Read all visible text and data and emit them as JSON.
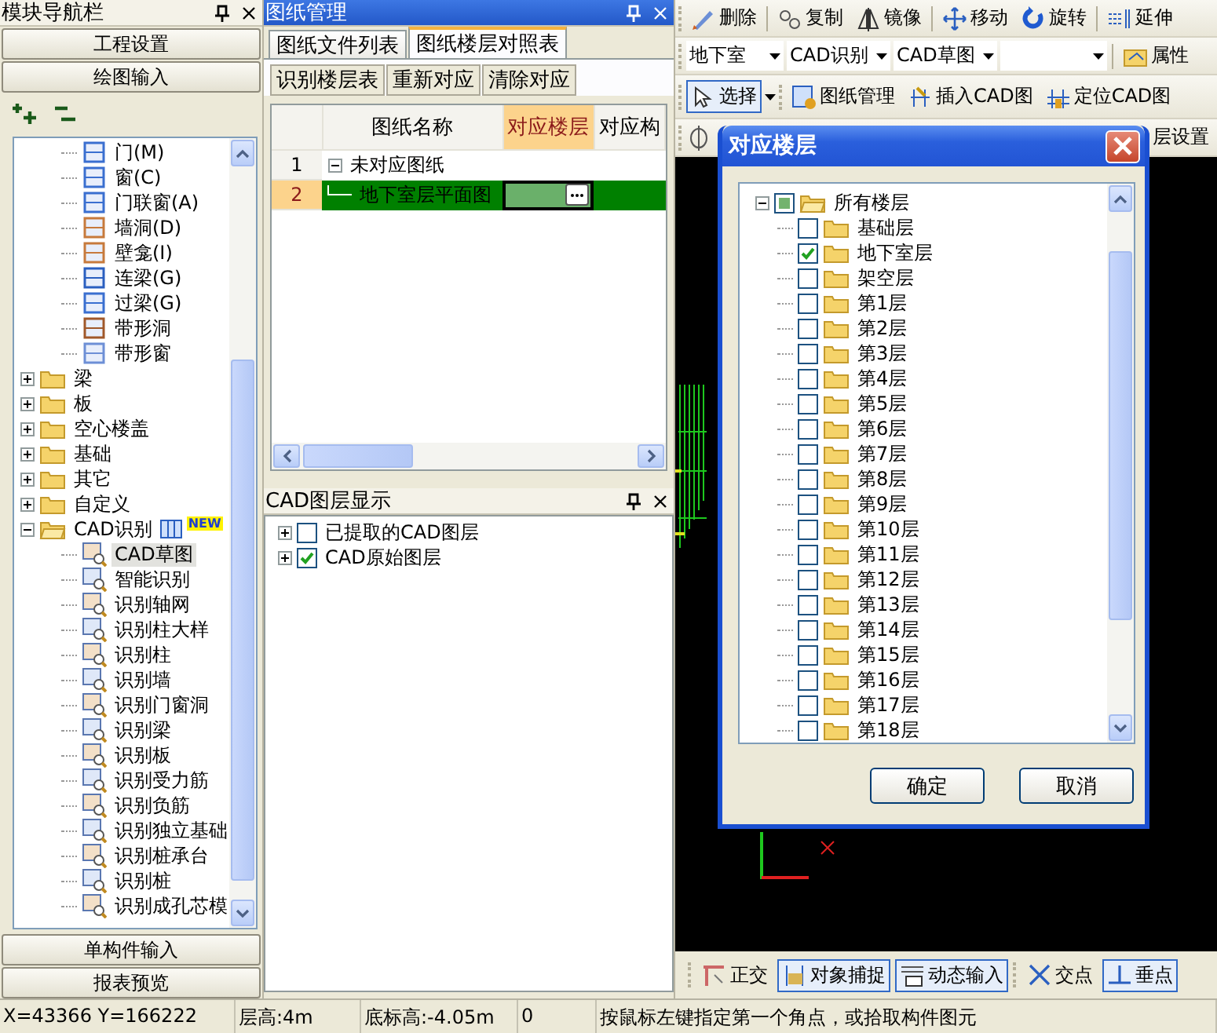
{
  "navigator": {
    "title": "模块导航栏",
    "top_buttons": [
      "工程设置",
      "绘图输入"
    ],
    "tree": {
      "scrolled_children": [
        {
          "label": "门(M)"
        },
        {
          "label": "窗(C)"
        },
        {
          "label": "门联窗(A)"
        },
        {
          "label": "墙洞(D)"
        },
        {
          "label": "壁龛(I)"
        },
        {
          "label": "连梁(G)"
        },
        {
          "label": "过梁(G)"
        },
        {
          "label": "带形洞"
        },
        {
          "label": "带形窗"
        }
      ],
      "items": [
        {
          "label": "梁",
          "expanded": false
        },
        {
          "label": "板",
          "expanded": false
        },
        {
          "label": "空心楼盖",
          "expanded": false
        },
        {
          "label": "基础",
          "expanded": false
        },
        {
          "label": "其它",
          "expanded": false
        },
        {
          "label": "自定义",
          "expanded": false
        },
        {
          "label": "CAD识别",
          "expanded": true,
          "badge": "NEW",
          "children": [
            {
              "label": "CAD草图",
              "selected": true
            },
            {
              "label": "智能识别",
              "selected": false
            },
            {
              "label": "识别轴网",
              "selected": false
            },
            {
              "label": "识别柱大样",
              "selected": false
            },
            {
              "label": "识别柱",
              "selected": false
            },
            {
              "label": "识别墙",
              "selected": false
            },
            {
              "label": "识别门窗洞",
              "selected": false
            },
            {
              "label": "识别梁",
              "selected": false
            },
            {
              "label": "识别板",
              "selected": false
            },
            {
              "label": "识别受力筋",
              "selected": false
            },
            {
              "label": "识别负筋",
              "selected": false
            },
            {
              "label": "识别独立基础",
              "selected": false
            },
            {
              "label": "识别桩承台",
              "selected": false
            },
            {
              "label": "识别桩",
              "selected": false
            },
            {
              "label": "识别成孔芯模",
              "selected": false
            }
          ]
        }
      ]
    },
    "bottom_buttons": [
      "单构件输入",
      "报表预览"
    ]
  },
  "drawings": {
    "title": "图纸管理",
    "tabs": [
      {
        "label": "图纸文件列表",
        "selected": false
      },
      {
        "label": "图纸楼层对照表",
        "selected": true
      }
    ],
    "buttons": [
      "识别楼层表",
      "重新对应",
      "清除对应"
    ],
    "columns": [
      {
        "label": "图纸名称",
        "selected": false
      },
      {
        "label": "对应楼层",
        "selected": true
      },
      {
        "label": "对应构",
        "selected": false
      }
    ],
    "rows": [
      {
        "number": "1",
        "name": "未对应图纸",
        "kind": "group",
        "expanded": true,
        "selected": false
      },
      {
        "number": "2",
        "name": "地下室层平面图",
        "kind": "child",
        "selected": true
      }
    ]
  },
  "cad_layers": {
    "title": "CAD图层显示",
    "items": [
      {
        "label": "已提取的CAD图层",
        "checked": false,
        "expanded": false
      },
      {
        "label": "CAD原始图层",
        "checked": true,
        "expanded": false
      }
    ]
  },
  "toolbar": {
    "edit_buttons": [
      "删除",
      "复制",
      "镜像",
      "移动",
      "旋转",
      "延伸"
    ],
    "selectors": [
      "地下室",
      "CAD识别",
      "CAD草图"
    ],
    "properties_button": "属性",
    "cad_buttons": [
      {
        "label": "选择",
        "pressed": true
      },
      {
        "label": "图纸管理",
        "pressed": false
      },
      {
        "label": "插入CAD图",
        "pressed": false
      },
      {
        "label": "定位CAD图",
        "pressed": false
      }
    ],
    "partial_button": "层设置"
  },
  "snap_toolbar": [
    {
      "label": "正交",
      "pressed": false
    },
    {
      "label": "对象捕捉",
      "pressed": true
    },
    {
      "label": "动态输入",
      "pressed": true
    },
    {
      "label": "交点",
      "pressed": false
    },
    {
      "label": "垂点",
      "pressed": true
    }
  ],
  "floor_dialog": {
    "title": "对应楼层",
    "root": {
      "label": "所有楼层",
      "checked": false,
      "partial": true,
      "expanded": true,
      "children": [
        {
          "label": "基础层",
          "checked": false
        },
        {
          "label": "地下室层",
          "checked": true
        },
        {
          "label": "架空层",
          "checked": false
        },
        {
          "label": "第1层",
          "checked": false
        },
        {
          "label": "第2层",
          "checked": false
        },
        {
          "label": "第3层",
          "checked": false
        },
        {
          "label": "第4层",
          "checked": false
        },
        {
          "label": "第5层",
          "checked": false
        },
        {
          "label": "第6层",
          "checked": false
        },
        {
          "label": "第7层",
          "checked": false
        },
        {
          "label": "第8层",
          "checked": false
        },
        {
          "label": "第9层",
          "checked": false
        },
        {
          "label": "第10层",
          "checked": false
        },
        {
          "label": "第11层",
          "checked": false
        },
        {
          "label": "第12层",
          "checked": false
        },
        {
          "label": "第13层",
          "checked": false
        },
        {
          "label": "第14层",
          "checked": false
        },
        {
          "label": "第15层",
          "checked": false
        },
        {
          "label": "第16层",
          "checked": false
        },
        {
          "label": "第17层",
          "checked": false
        },
        {
          "label": "第18层",
          "checked": false
        }
      ]
    },
    "buttons": [
      "确定",
      "取消"
    ]
  },
  "status_bar": [
    "X=43366 Y=166222",
    "层高:4m",
    "底标高:-4.05m",
    "0",
    "按鼠标左键指定第一个角点，或拾取构件图元"
  ]
}
